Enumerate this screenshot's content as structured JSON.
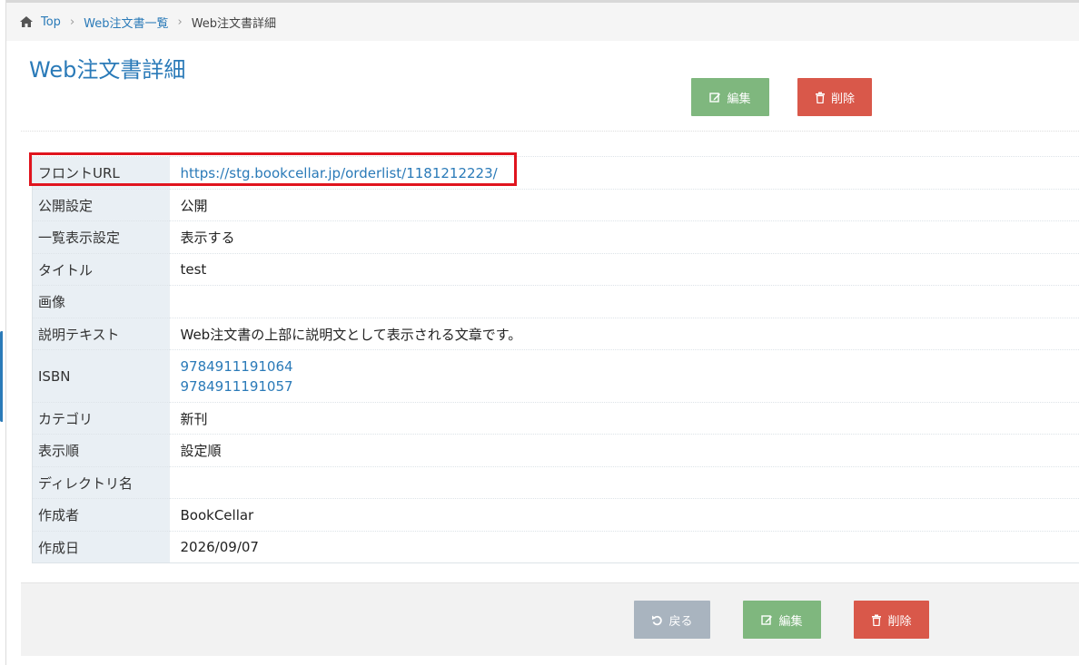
{
  "breadcrumb": {
    "top": "Top",
    "list": "Web注文書一覧",
    "current": "Web注文書詳細",
    "sep": "›"
  },
  "page_title": "Web注文書詳細",
  "buttons": {
    "edit": "編集",
    "delete": "削除",
    "back": "戻る"
  },
  "details": [
    {
      "label": "フロントURL",
      "value": "https://stg.bookcellar.jp/orderlist/1181212223/"
    },
    {
      "label": "公開設定",
      "value": "公開"
    },
    {
      "label": "一覧表示設定",
      "value": "表示する"
    },
    {
      "label": "タイトル",
      "value": "test"
    },
    {
      "label": "画像",
      "value": ""
    },
    {
      "label": "説明テキスト",
      "value": "Web注文書の上部に説明文として表示される文章です。"
    },
    {
      "label": "ISBN",
      "values": [
        "9784911191064",
        "9784911191057"
      ]
    },
    {
      "label": "カテゴリ",
      "value": "新刊"
    },
    {
      "label": "表示順",
      "value": "設定順"
    },
    {
      "label": "ディレクトリ名",
      "value": ""
    },
    {
      "label": "作成者",
      "value": "BookCellar"
    },
    {
      "label": "作成日",
      "value": "2026/09/07"
    }
  ],
  "colors": {
    "accent": "#2a7ab8",
    "edit": "#7fb77e",
    "delete": "#d9584a",
    "back": "#a9b4bf",
    "highlight": "#e0141e"
  },
  "icons": [
    "home-icon",
    "edit-icon",
    "trash-icon",
    "undo-icon"
  ]
}
